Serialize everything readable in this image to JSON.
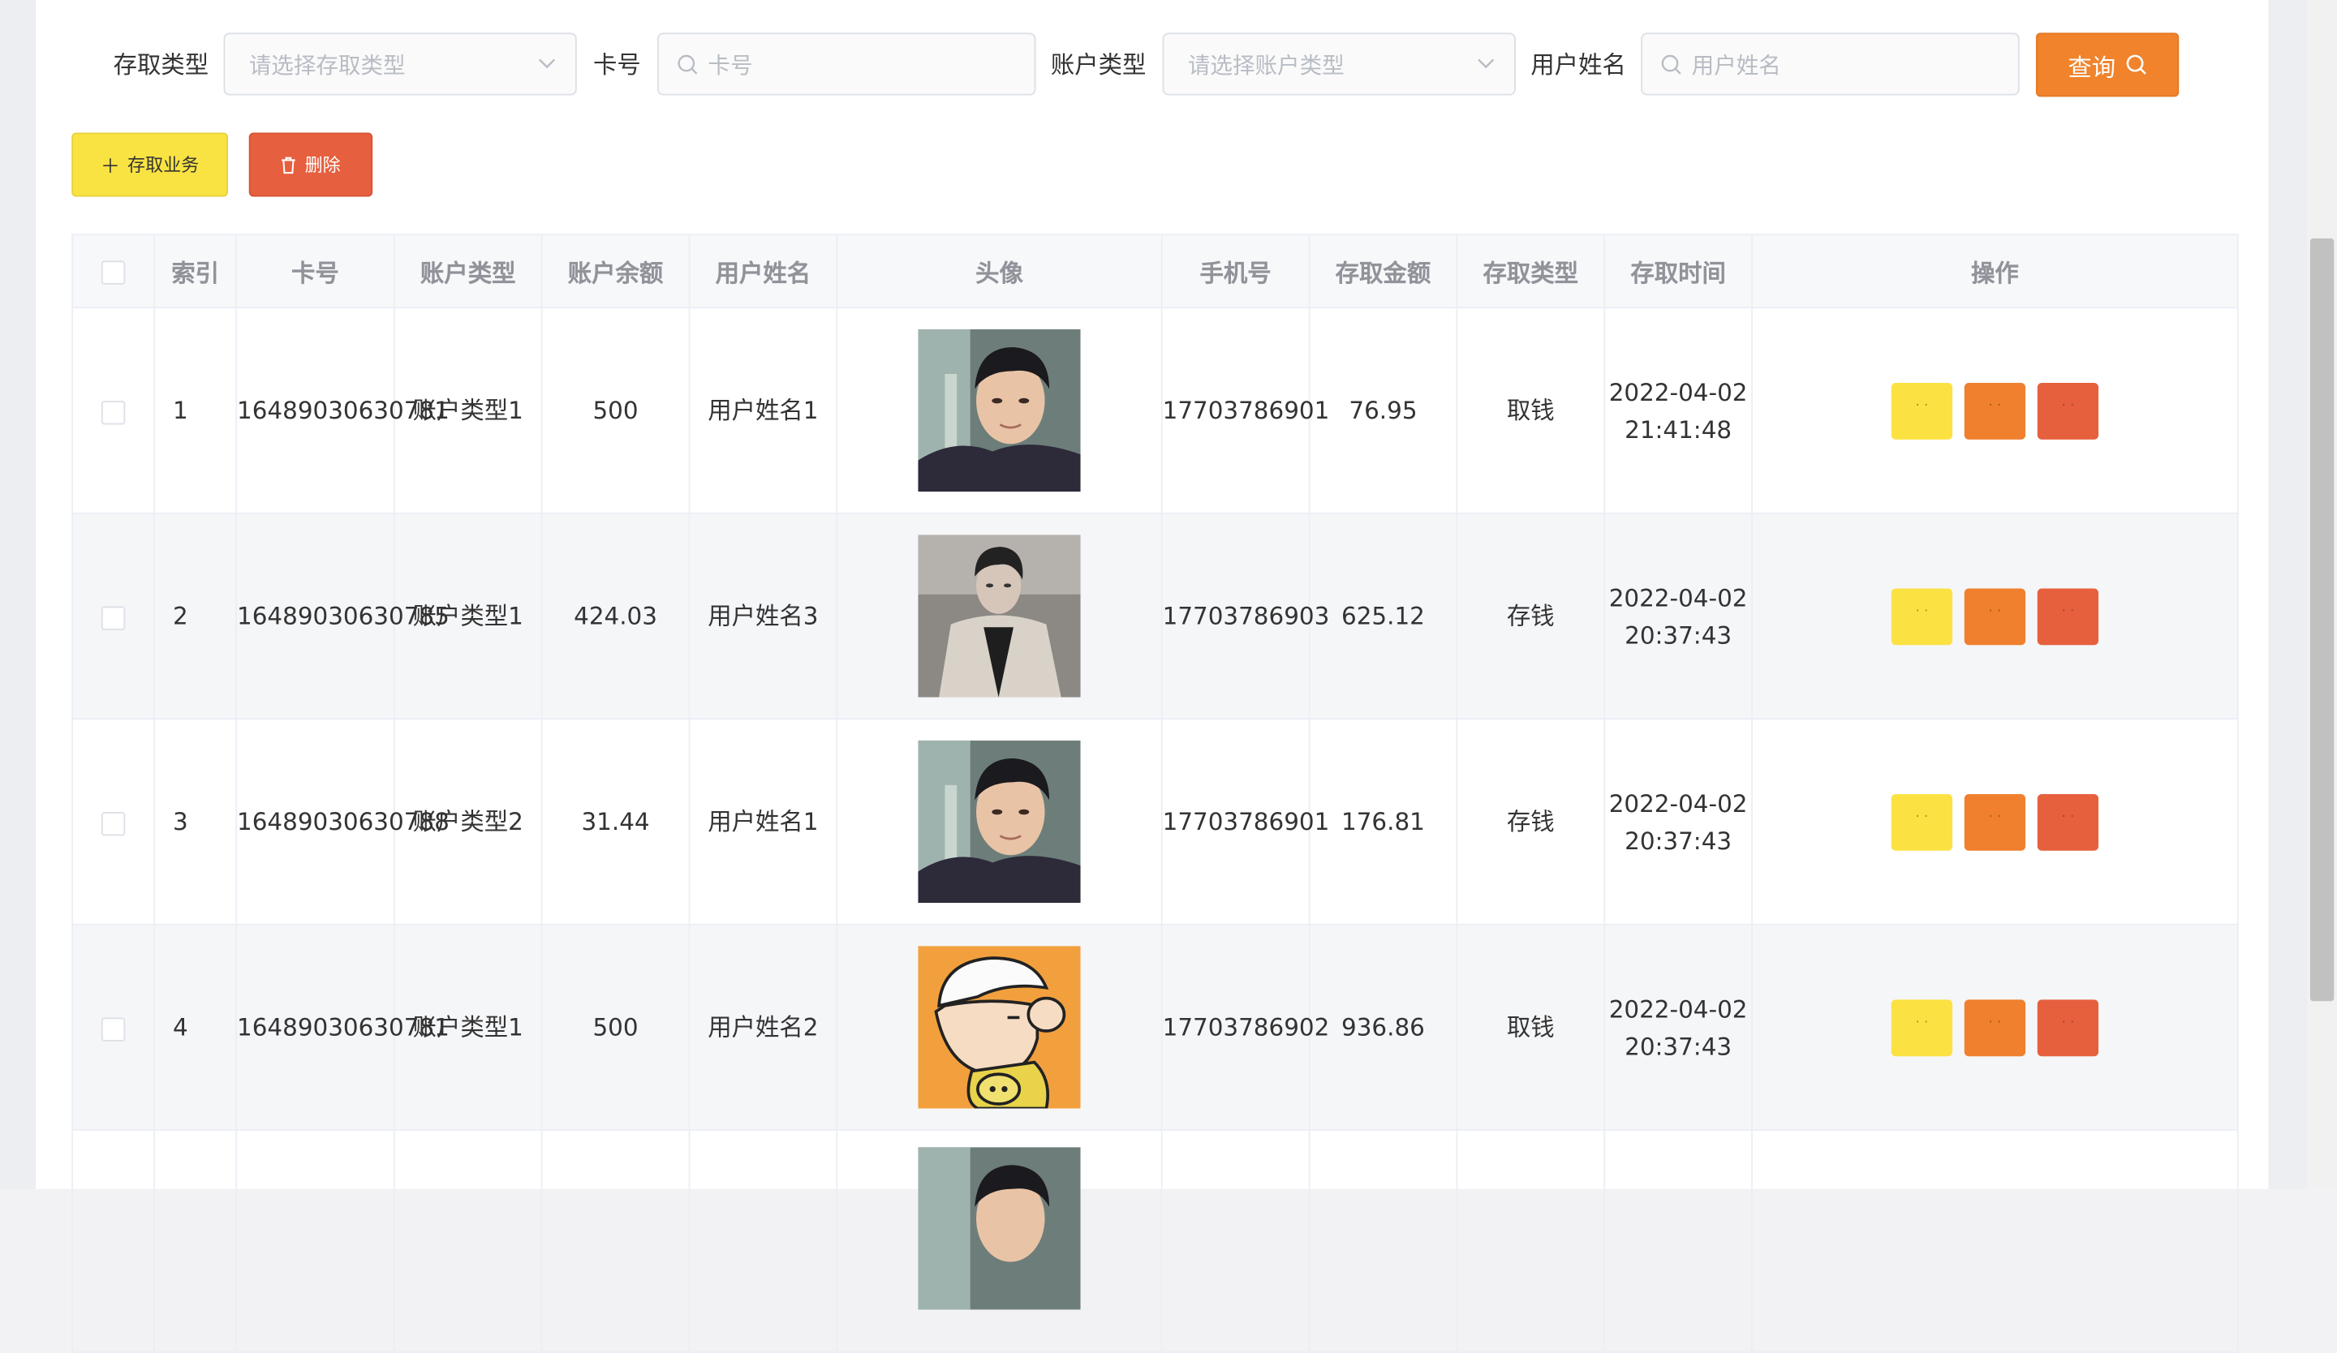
{
  "filters": {
    "type_label": "存取类型",
    "type_placeholder": "请选择存取类型",
    "card_label": "卡号",
    "card_placeholder": "卡号",
    "account_type_label": "账户类型",
    "account_type_placeholder": "请选择账户类型",
    "username_label": "用户姓名",
    "username_placeholder": "用户姓名",
    "query_button": "查询"
  },
  "actions": {
    "add_button": "存取业务",
    "delete_button": "删除"
  },
  "table": {
    "columns": [
      "索引",
      "卡号",
      "账户类型",
      "账户余额",
      "用户姓名",
      "头像",
      "手机号",
      "存取金额",
      "存取类型",
      "存取时间",
      "操作"
    ],
    "rows": [
      {
        "index": "1",
        "card": "16489030630781",
        "account_type": "账户类型1",
        "balance": "500",
        "username": "用户姓名1",
        "avatar": "man-portrait-icon",
        "phone": "17703786901",
        "amount": "76.95",
        "txn_type": "取钱",
        "time": "2022-04-02 21:41:48"
      },
      {
        "index": "2",
        "card": "16489030630785",
        "account_type": "账户类型1",
        "balance": "424.03",
        "username": "用户姓名3",
        "avatar": "man-coat-photo-icon",
        "phone": "17703786903",
        "amount": "625.12",
        "txn_type": "存钱",
        "time": "2022-04-02 20:37:43"
      },
      {
        "index": "3",
        "card": "16489030630788",
        "account_type": "账户类型2",
        "balance": "31.44",
        "username": "用户姓名1",
        "avatar": "man-portrait-icon",
        "phone": "17703786901",
        "amount": "176.81",
        "txn_type": "存钱",
        "time": "2022-04-02 20:37:43"
      },
      {
        "index": "4",
        "card": "16489030630781",
        "account_type": "账户类型1",
        "balance": "500",
        "username": "用户姓名2",
        "avatar": "cartoon-boy-icon",
        "phone": "17703786902",
        "amount": "936.86",
        "txn_type": "取钱",
        "time": "2022-04-02 20:37:43"
      }
    ]
  },
  "colors": {
    "query": "#f0832c",
    "add": "#f9e343",
    "delete": "#e65f3e",
    "view": "#fbe242",
    "edit": "#f0802e",
    "remove": "#e6603d"
  }
}
